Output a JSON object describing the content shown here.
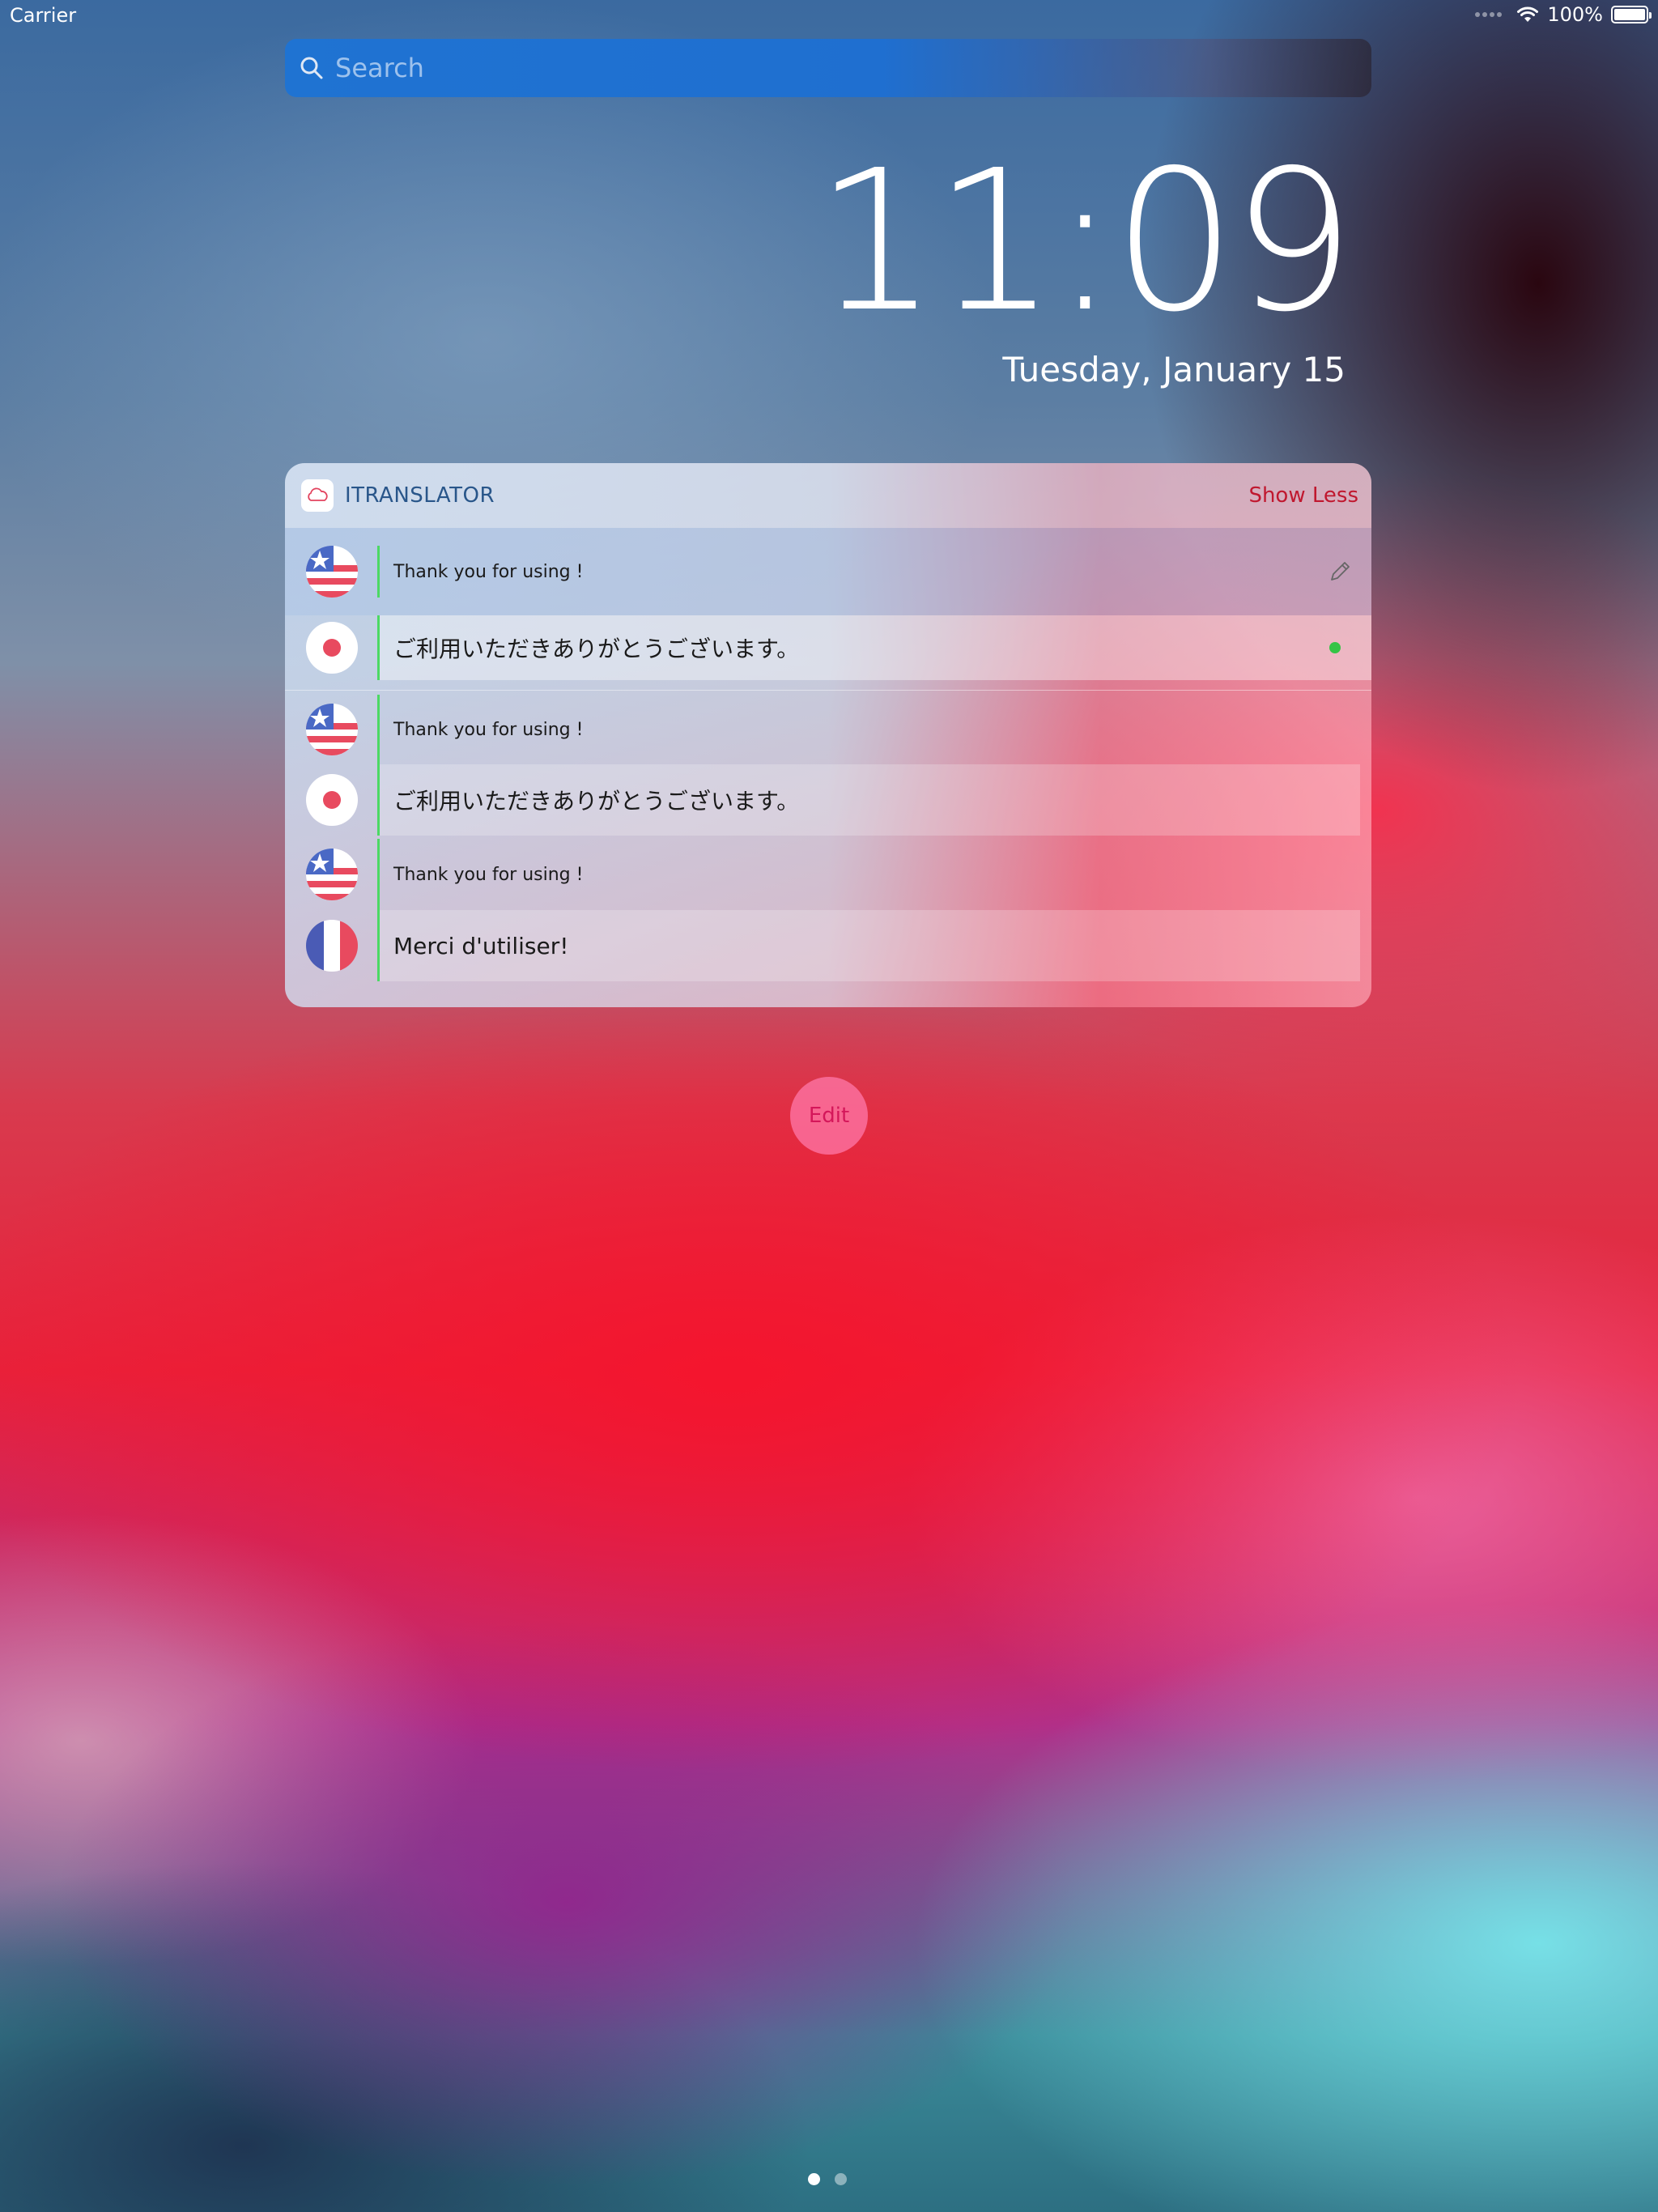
{
  "status_bar": {
    "carrier": "Carrier",
    "battery": "100%"
  },
  "search": {
    "placeholder": "Search"
  },
  "lockscreen": {
    "time": "11:09",
    "date": "Tuesday, January 15"
  },
  "widget": {
    "app_name": "ITRANSLATOR",
    "show_less_label": "Show Less",
    "entries": [
      {
        "source": {
          "flag": "us-flag-icon",
          "text": "Thank you for using !"
        },
        "target": {
          "flag": "japan-flag-icon",
          "text": "ご利用いただきありがとうございます。"
        }
      },
      {
        "source": {
          "flag": "us-flag-icon",
          "text": "Thank you for using !"
        },
        "target": {
          "flag": "japan-flag-icon",
          "text": "ご利用いただきありがとうございます。"
        }
      },
      {
        "source": {
          "flag": "us-flag-icon",
          "text": "Thank you for using !"
        },
        "target": {
          "flag": "france-flag-icon",
          "text": "Merci d'utiliser!"
        }
      }
    ]
  },
  "edit_label": "Edit",
  "page_indicator": {
    "count": 2,
    "current": 1
  },
  "colors": {
    "accent_red": "#c0182f",
    "divider_green": "#4cd964",
    "status_dot": "#35c446"
  }
}
